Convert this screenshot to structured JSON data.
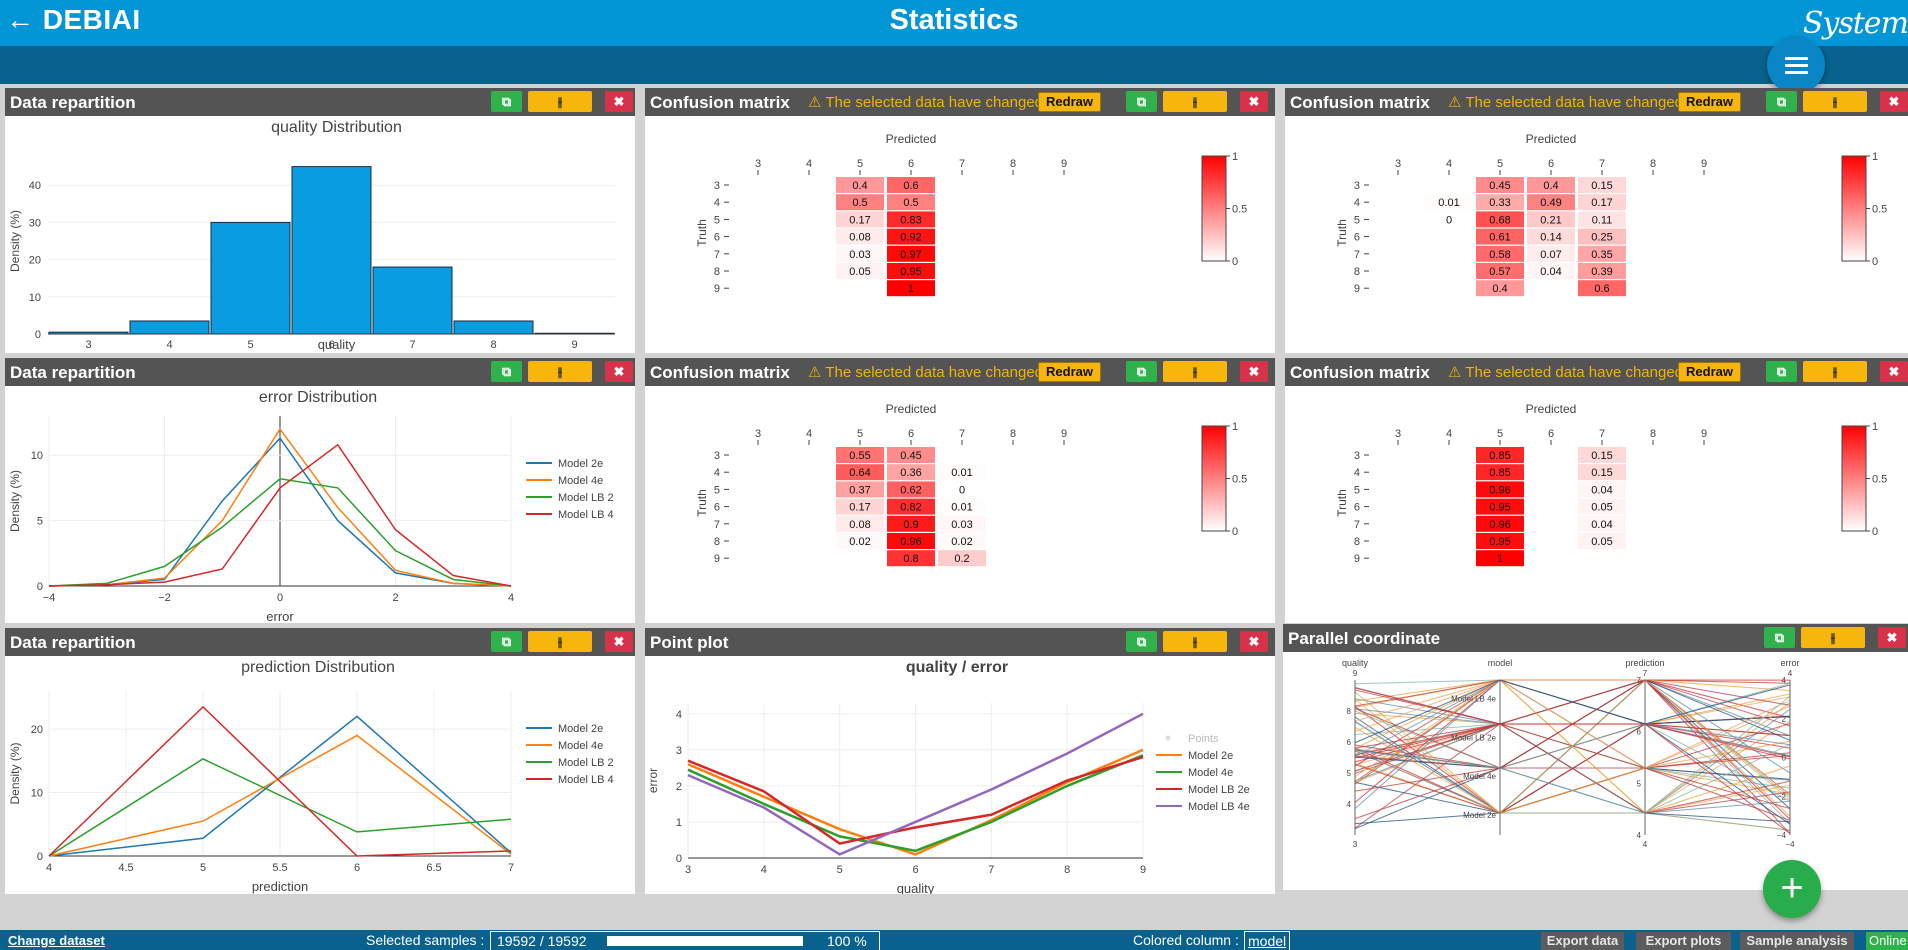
{
  "header": {
    "back_label": "← DEBIAI",
    "title": "Statistics",
    "brand": "System"
  },
  "footer": {
    "change_dataset": "Change dataset",
    "selected_label": "Selected samples :",
    "selected_value": "19592 / 19592",
    "selected_fraction": 1.0,
    "percent": "100 %",
    "colored_label": "Colored column :",
    "colored_value": "model",
    "buttons": [
      "Export data",
      "Export plots",
      "Sample analysis"
    ],
    "status": "Online"
  },
  "colors": {
    "header": "#0296d7",
    "subbar": "#08628d",
    "widget_header": "#545454",
    "bar": "#0a9ce0",
    "copy": "#2fb14b",
    "settings": "#f7b60c",
    "close": "#d8324b",
    "warning": "#f0b400"
  },
  "widgets": {
    "w1": {
      "title": "Data repartition"
    },
    "w2": {
      "title": "Confusion matrix",
      "warning": "⚠ The selected data have changed",
      "redraw": "Redraw"
    },
    "w3": {
      "title": "Confusion matrix",
      "warning": "⚠ The selected data have changed",
      "redraw": "Redraw"
    },
    "w4": {
      "title": "Data repartition"
    },
    "w5": {
      "title": "Confusion matrix",
      "warning": "⚠ The selected data have changed",
      "redraw": "Redraw"
    },
    "w6": {
      "title": "Confusion matrix",
      "warning": "⚠ The selected data have changed",
      "redraw": "Redraw"
    },
    "w7": {
      "title": "Data repartition"
    },
    "w8": {
      "title": "Point plot"
    },
    "w9": {
      "title": "Parallel coordinate"
    }
  },
  "chart_data": [
    {
      "id": "w1",
      "type": "bar",
      "title": "quality Distribution",
      "xlabel": "quality",
      "ylabel": "Density (%)",
      "categories": [
        "3",
        "4",
        "5",
        "6",
        "7",
        "8",
        "9"
      ],
      "values": [
        0.5,
        3.5,
        30,
        45,
        18,
        3.5,
        0.2
      ],
      "ylim": [
        0,
        50
      ],
      "yticks": [
        0,
        10,
        20,
        30,
        40
      ]
    },
    {
      "id": "w2",
      "type": "heatmap",
      "xlabel": "Predicted",
      "ylabel": "Truth",
      "x": [
        "3",
        "4",
        "5",
        "6",
        "7",
        "8",
        "9"
      ],
      "y": [
        "3",
        "4",
        "5",
        "6",
        "7",
        "8",
        "9"
      ],
      "cells": [
        [
          null,
          null,
          0.4,
          0.6,
          null,
          null,
          null
        ],
        [
          null,
          null,
          0.5,
          0.5,
          null,
          null,
          null
        ],
        [
          null,
          null,
          0.17,
          0.83,
          null,
          null,
          null
        ],
        [
          null,
          null,
          0.08,
          0.92,
          null,
          null,
          null
        ],
        [
          null,
          null,
          0.03,
          0.97,
          null,
          null,
          null
        ],
        [
          null,
          null,
          0.05,
          0.95,
          null,
          null,
          null
        ],
        [
          null,
          null,
          null,
          1,
          null,
          null,
          null
        ]
      ],
      "colorscale_ticks": [
        "1",
        "0.5",
        "0"
      ]
    },
    {
      "id": "w3",
      "type": "heatmap",
      "xlabel": "Predicted",
      "ylabel": "Truth",
      "x": [
        "3",
        "4",
        "5",
        "6",
        "7",
        "8",
        "9"
      ],
      "y": [
        "3",
        "4",
        "5",
        "6",
        "7",
        "8",
        "9"
      ],
      "cells": [
        [
          null,
          null,
          0.45,
          0.4,
          0.15,
          null,
          null
        ],
        [
          null,
          0.01,
          0.33,
          0.49,
          0.17,
          null,
          null
        ],
        [
          null,
          0,
          0.68,
          0.21,
          0.11,
          null,
          null
        ],
        [
          null,
          null,
          0.61,
          0.14,
          0.25,
          null,
          null
        ],
        [
          null,
          null,
          0.58,
          0.07,
          0.35,
          null,
          null
        ],
        [
          null,
          null,
          0.57,
          0.04,
          0.39,
          null,
          null
        ],
        [
          null,
          null,
          0.4,
          null,
          0.6,
          null,
          null
        ]
      ],
      "colorscale_ticks": [
        "1",
        "0.5",
        "0"
      ]
    },
    {
      "id": "w4",
      "type": "line",
      "title": "error Distribution",
      "xlabel": "error",
      "ylabel": "Density (%)",
      "xlim": [
        -4,
        4
      ],
      "ylim": [
        0,
        13
      ],
      "xticks": [
        -4,
        -2,
        0,
        2,
        4
      ],
      "xtick_labels": [
        "−4",
        "−2",
        "0",
        "2",
        "4"
      ],
      "yticks": [
        0,
        5,
        10
      ],
      "series": [
        {
          "name": "Model 2e",
          "color": "#1f77b4",
          "x": [
            -4,
            -3,
            -2,
            -1,
            0,
            1,
            2,
            3,
            4
          ],
          "y": [
            0,
            0.1,
            0.5,
            6.5,
            11.3,
            5,
            1,
            0.2,
            0
          ]
        },
        {
          "name": "Model 4e",
          "color": "#ff7f0e",
          "x": [
            -4,
            -3,
            -2,
            -1,
            0,
            1,
            2,
            3,
            4
          ],
          "y": [
            0,
            0.1,
            0.6,
            5,
            12,
            6,
            1.2,
            0.2,
            0
          ]
        },
        {
          "name": "Model LB 2",
          "color": "#2ca02c",
          "x": [
            -4,
            -3,
            -2,
            -1,
            0,
            1,
            2,
            3,
            4
          ],
          "y": [
            0,
            0.2,
            1.5,
            4.5,
            8.2,
            7.5,
            2.7,
            0.5,
            0
          ]
        },
        {
          "name": "Model LB 4",
          "color": "#d62728",
          "x": [
            -4,
            -3,
            -2,
            -1,
            0,
            1,
            2,
            3,
            4
          ],
          "y": [
            0,
            0.1,
            0.3,
            1.3,
            7.5,
            10.8,
            4.3,
            0.8,
            0
          ]
        }
      ]
    },
    {
      "id": "w5",
      "type": "heatmap",
      "xlabel": "Predicted",
      "ylabel": "Truth",
      "x": [
        "3",
        "4",
        "5",
        "6",
        "7",
        "8",
        "9"
      ],
      "y": [
        "3",
        "4",
        "5",
        "6",
        "7",
        "8",
        "9"
      ],
      "cells": [
        [
          null,
          null,
          0.55,
          0.45,
          null,
          null,
          null
        ],
        [
          null,
          null,
          0.64,
          0.36,
          0.01,
          null,
          null
        ],
        [
          null,
          null,
          0.37,
          0.62,
          0,
          null,
          null
        ],
        [
          null,
          null,
          0.17,
          0.82,
          0.01,
          null,
          null
        ],
        [
          null,
          null,
          0.08,
          0.9,
          0.03,
          null,
          null
        ],
        [
          null,
          null,
          0.02,
          0.96,
          0.02,
          null,
          null
        ],
        [
          null,
          null,
          null,
          0.8,
          0.2,
          null,
          null
        ]
      ],
      "colorscale_ticks": [
        "1",
        "0.5",
        "0"
      ]
    },
    {
      "id": "w6",
      "type": "heatmap",
      "xlabel": "Predicted",
      "ylabel": "Truth",
      "x": [
        "3",
        "4",
        "5",
        "6",
        "7",
        "8",
        "9"
      ],
      "y": [
        "3",
        "4",
        "5",
        "6",
        "7",
        "8",
        "9"
      ],
      "cells": [
        [
          null,
          null,
          0.85,
          null,
          0.15,
          null,
          null
        ],
        [
          null,
          null,
          0.85,
          null,
          0.15,
          null,
          null
        ],
        [
          null,
          null,
          0.96,
          null,
          0.04,
          null,
          null
        ],
        [
          null,
          null,
          0.95,
          null,
          0.05,
          null,
          null
        ],
        [
          null,
          null,
          0.96,
          null,
          0.04,
          null,
          null
        ],
        [
          null,
          null,
          0.95,
          null,
          0.05,
          null,
          null
        ],
        [
          null,
          null,
          1,
          null,
          null,
          null,
          null
        ]
      ],
      "colorscale_ticks": [
        "1",
        "0.5",
        "0"
      ]
    },
    {
      "id": "w7",
      "type": "line",
      "title": "prediction Distribution",
      "xlabel": "prediction",
      "ylabel": "Density (%)",
      "xlim": [
        4,
        7
      ],
      "ylim": [
        0,
        26
      ],
      "xticks": [
        4,
        4.5,
        5,
        5.5,
        6,
        6.5,
        7
      ],
      "xtick_labels": [
        "4",
        "4.5",
        "5",
        "5.5",
        "6",
        "6.5",
        "7"
      ],
      "yticks": [
        0,
        10,
        20
      ],
      "series": [
        {
          "name": "Model 2e",
          "color": "#1f77b4",
          "x": [
            4,
            5,
            6,
            7
          ],
          "y": [
            0,
            2.8,
            22,
            0.5
          ]
        },
        {
          "name": "Model 4e",
          "color": "#ff7f0e",
          "x": [
            4,
            5,
            6,
            7
          ],
          "y": [
            0,
            5.5,
            19,
            0.3
          ]
        },
        {
          "name": "Model LB 2",
          "color": "#2ca02c",
          "x": [
            4,
            5,
            6,
            7
          ],
          "y": [
            0,
            15.3,
            3.8,
            5.8
          ]
        },
        {
          "name": "Model LB 4",
          "color": "#d62728",
          "x": [
            4,
            5,
            6,
            7
          ],
          "y": [
            0,
            23.5,
            0,
            0.8
          ]
        }
      ]
    },
    {
      "id": "w8",
      "type": "line",
      "title": "quality / error",
      "xlabel": "quality",
      "ylabel": "error",
      "xlim": [
        3,
        9
      ],
      "ylim": [
        0,
        4.3
      ],
      "xticks": [
        3,
        4,
        5,
        6,
        7,
        8,
        9
      ],
      "xtick_labels": [
        "3",
        "4",
        "5",
        "6",
        "7",
        "8",
        "9"
      ],
      "yticks": [
        0,
        1,
        2,
        3,
        4
      ],
      "legend_points": "Points",
      "series": [
        {
          "name": "Model 2e",
          "color": "#ff7f0e",
          "x": [
            3,
            4,
            5,
            6,
            7,
            8,
            9
          ],
          "y": [
            2.6,
            1.7,
            0.8,
            0.1,
            1.05,
            2.1,
            3
          ]
        },
        {
          "name": "Model 4e",
          "color": "#2ca02c",
          "x": [
            3,
            4,
            5,
            6,
            7,
            8,
            9
          ],
          "y": [
            2.45,
            1.5,
            0.6,
            0.2,
            1.0,
            2.0,
            2.85
          ]
        },
        {
          "name": "Model LB 2e",
          "color": "#d62728",
          "x": [
            3,
            4,
            5,
            6,
            7,
            8,
            9
          ],
          "y": [
            2.7,
            1.85,
            0.4,
            0.85,
            1.2,
            2.15,
            2.8
          ]
        },
        {
          "name": "Model LB 4e",
          "color": "#9467bd",
          "x": [
            3,
            4,
            5,
            6,
            7,
            8,
            9
          ],
          "y": [
            2.3,
            1.4,
            0.1,
            1.0,
            1.9,
            2.9,
            4.0
          ]
        }
      ]
    },
    {
      "id": "w9",
      "type": "parallel",
      "axes": [
        {
          "label": "quality",
          "top": "9",
          "bottom": "3",
          "ticks": [
            "9",
            "8",
            "6",
            "5",
            "4",
            "3"
          ]
        },
        {
          "label": "model",
          "top": "",
          "bottom": "",
          "ticks": [
            "Model LB 4e",
            "Model LB 2e",
            "Model 4e",
            "Model 2e"
          ]
        },
        {
          "label": "prediction",
          "top": "7",
          "bottom": "4",
          "ticks": [
            "7",
            "6",
            "5",
            "4"
          ]
        },
        {
          "label": "error",
          "top": "4",
          "bottom": "−4",
          "ticks": [
            "4",
            "2",
            "0",
            "−2",
            "−4"
          ]
        }
      ]
    }
  ]
}
